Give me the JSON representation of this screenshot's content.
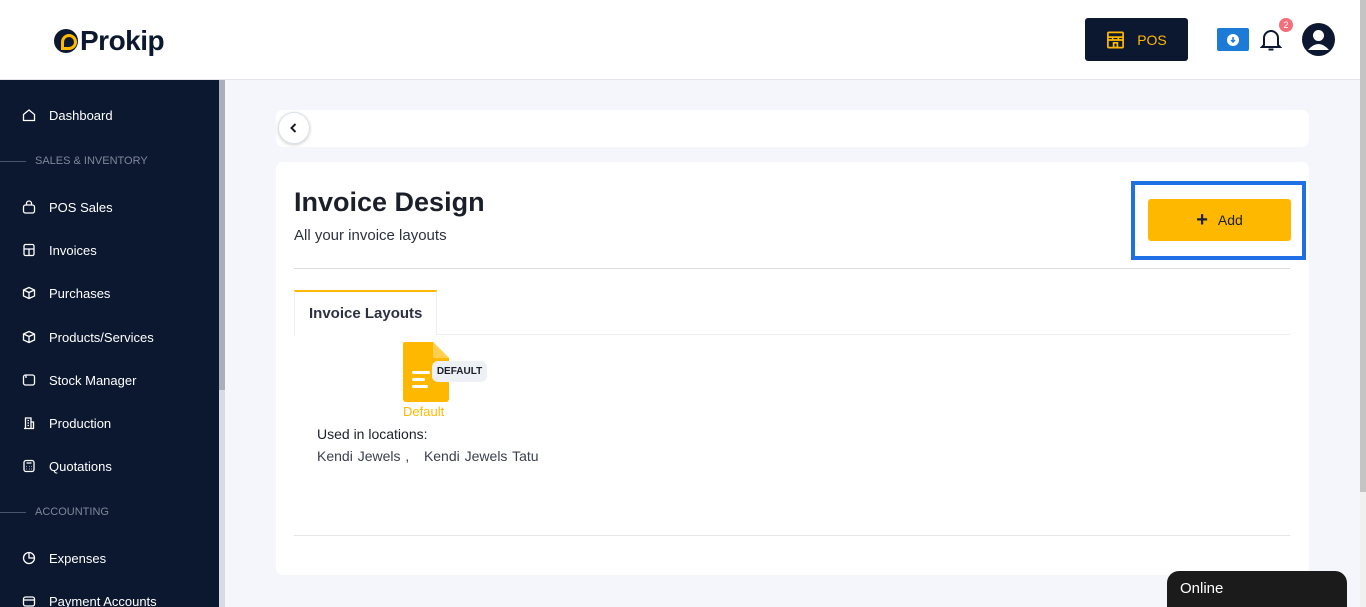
{
  "header": {
    "logo_text": "Prokip",
    "pos_label": "POS",
    "notification_count": "2"
  },
  "sidebar": {
    "items": [
      {
        "label": "Dashboard",
        "icon": "home-icon"
      },
      {
        "label": "POS Sales",
        "icon": "shopping-bag-icon"
      },
      {
        "label": "Invoices",
        "icon": "invoice-icon"
      },
      {
        "label": "Purchases",
        "icon": "box-gear-icon"
      },
      {
        "label": "Products/Services",
        "icon": "cube-icon"
      },
      {
        "label": "Stock Manager",
        "icon": "folder-icon"
      },
      {
        "label": "Production",
        "icon": "building-icon"
      },
      {
        "label": "Quotations",
        "icon": "calculator-icon"
      },
      {
        "label": "Expenses",
        "icon": "pie-chart-icon"
      },
      {
        "label": "Payment Accounts",
        "icon": "wallet-icon"
      }
    ],
    "sections": [
      "SALES & INVENTORY",
      "ACCOUNTING"
    ]
  },
  "page": {
    "title": "Invoice Design",
    "subtitle": "All your invoice layouts",
    "add_label": "Add",
    "tab_label": "Invoice Layouts"
  },
  "layout_card": {
    "badge": "DEFAULT",
    "name": "Default",
    "used_label": "Used in locations:",
    "locations": "Kendi Jewels ,   Kendi Jewels Tatu"
  },
  "chat": {
    "status": "Online"
  },
  "colors": {
    "navy": "#0c1830",
    "accent": "#ffb800",
    "highlight": "#1f6fe5",
    "download_blue": "#1d7bd8"
  }
}
